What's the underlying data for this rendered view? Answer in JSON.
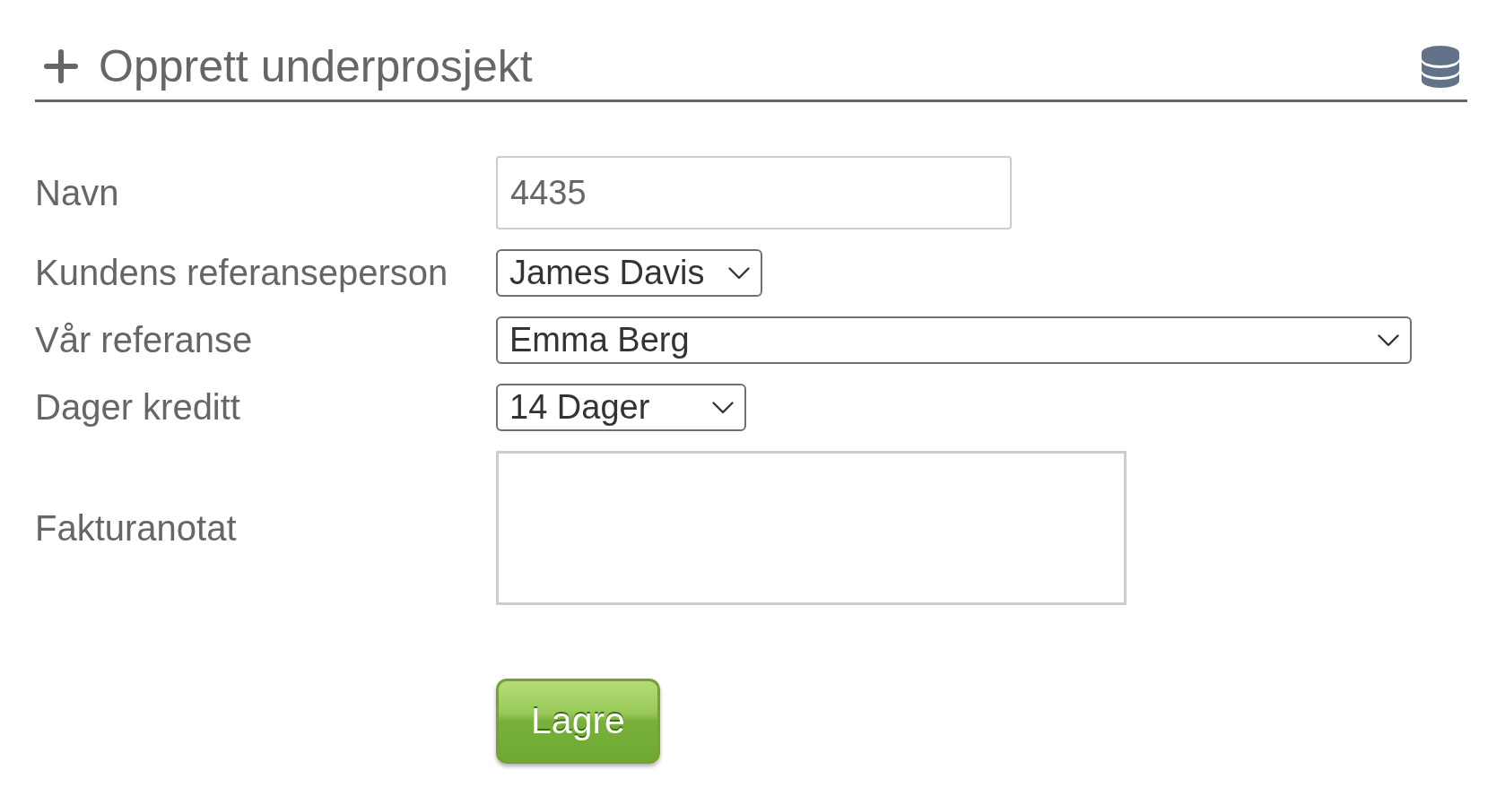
{
  "header": {
    "title": "Opprett underprosjekt"
  },
  "form": {
    "fields": [
      {
        "kind": "text",
        "label": "Navn",
        "value": "4435"
      },
      {
        "kind": "select",
        "label": "Kundens referanseperson",
        "value": "James Davis"
      },
      {
        "kind": "select",
        "label": "Vår referanse",
        "value": "Emma Berg"
      },
      {
        "kind": "select",
        "label": "Dager kreditt",
        "value": "14 Dager"
      },
      {
        "kind": "textarea",
        "label": "Fakturanotat"
      }
    ],
    "buttons": [
      {
        "label": "Lagre"
      }
    ]
  }
}
